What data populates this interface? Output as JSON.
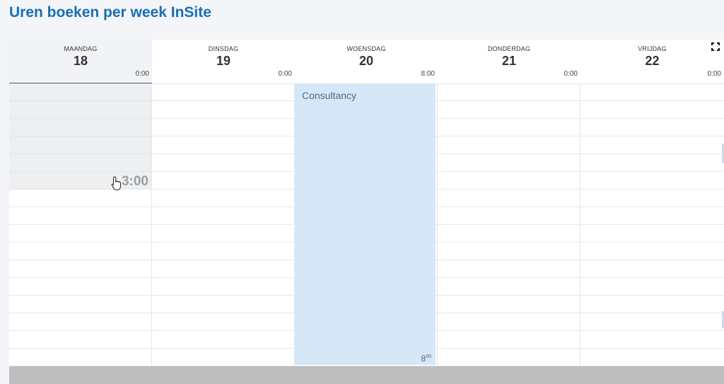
{
  "page": {
    "title": "Uren boeken per week InSite"
  },
  "calendar": {
    "days": [
      {
        "name": "MAANDAG",
        "date": "18",
        "total": "0:00"
      },
      {
        "name": "DINSDAG",
        "date": "19",
        "total": "0:00"
      },
      {
        "name": "WOENSDAG",
        "date": "20",
        "total": "8:00"
      },
      {
        "name": "DONDERDAG",
        "date": "21",
        "total": "0:00"
      },
      {
        "name": "VRIJDAG",
        "date": "22",
        "total": "0:00"
      }
    ],
    "hover_time": "3:00",
    "event": {
      "title": "Consultancy",
      "duration_main": "8",
      "duration_sup": "00"
    },
    "icons": {
      "fullscreen": "fullscreen-icon",
      "cursor": "hand-cursor-icon"
    }
  }
}
